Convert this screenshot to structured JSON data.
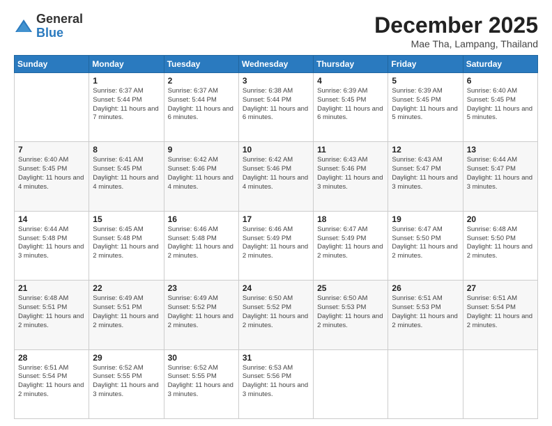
{
  "logo": {
    "general": "General",
    "blue": "Blue"
  },
  "title": {
    "month": "December 2025",
    "location": "Mae Tha, Lampang, Thailand"
  },
  "headers": [
    "Sunday",
    "Monday",
    "Tuesday",
    "Wednesday",
    "Thursday",
    "Friday",
    "Saturday"
  ],
  "weeks": [
    [
      {
        "day": "",
        "info": ""
      },
      {
        "day": "1",
        "info": "Sunrise: 6:37 AM\nSunset: 5:44 PM\nDaylight: 11 hours\nand 7 minutes."
      },
      {
        "day": "2",
        "info": "Sunrise: 6:37 AM\nSunset: 5:44 PM\nDaylight: 11 hours\nand 6 minutes."
      },
      {
        "day": "3",
        "info": "Sunrise: 6:38 AM\nSunset: 5:44 PM\nDaylight: 11 hours\nand 6 minutes."
      },
      {
        "day": "4",
        "info": "Sunrise: 6:39 AM\nSunset: 5:45 PM\nDaylight: 11 hours\nand 6 minutes."
      },
      {
        "day": "5",
        "info": "Sunrise: 6:39 AM\nSunset: 5:45 PM\nDaylight: 11 hours\nand 5 minutes."
      },
      {
        "day": "6",
        "info": "Sunrise: 6:40 AM\nSunset: 5:45 PM\nDaylight: 11 hours\nand 5 minutes."
      }
    ],
    [
      {
        "day": "7",
        "info": "Sunrise: 6:40 AM\nSunset: 5:45 PM\nDaylight: 11 hours\nand 4 minutes."
      },
      {
        "day": "8",
        "info": "Sunrise: 6:41 AM\nSunset: 5:45 PM\nDaylight: 11 hours\nand 4 minutes."
      },
      {
        "day": "9",
        "info": "Sunrise: 6:42 AM\nSunset: 5:46 PM\nDaylight: 11 hours\nand 4 minutes."
      },
      {
        "day": "10",
        "info": "Sunrise: 6:42 AM\nSunset: 5:46 PM\nDaylight: 11 hours\nand 4 minutes."
      },
      {
        "day": "11",
        "info": "Sunrise: 6:43 AM\nSunset: 5:46 PM\nDaylight: 11 hours\nand 3 minutes."
      },
      {
        "day": "12",
        "info": "Sunrise: 6:43 AM\nSunset: 5:47 PM\nDaylight: 11 hours\nand 3 minutes."
      },
      {
        "day": "13",
        "info": "Sunrise: 6:44 AM\nSunset: 5:47 PM\nDaylight: 11 hours\nand 3 minutes."
      }
    ],
    [
      {
        "day": "14",
        "info": "Sunrise: 6:44 AM\nSunset: 5:48 PM\nDaylight: 11 hours\nand 3 minutes."
      },
      {
        "day": "15",
        "info": "Sunrise: 6:45 AM\nSunset: 5:48 PM\nDaylight: 11 hours\nand 2 minutes."
      },
      {
        "day": "16",
        "info": "Sunrise: 6:46 AM\nSunset: 5:48 PM\nDaylight: 11 hours\nand 2 minutes."
      },
      {
        "day": "17",
        "info": "Sunrise: 6:46 AM\nSunset: 5:49 PM\nDaylight: 11 hours\nand 2 minutes."
      },
      {
        "day": "18",
        "info": "Sunrise: 6:47 AM\nSunset: 5:49 PM\nDaylight: 11 hours\nand 2 minutes."
      },
      {
        "day": "19",
        "info": "Sunrise: 6:47 AM\nSunset: 5:50 PM\nDaylight: 11 hours\nand 2 minutes."
      },
      {
        "day": "20",
        "info": "Sunrise: 6:48 AM\nSunset: 5:50 PM\nDaylight: 11 hours\nand 2 minutes."
      }
    ],
    [
      {
        "day": "21",
        "info": "Sunrise: 6:48 AM\nSunset: 5:51 PM\nDaylight: 11 hours\nand 2 minutes."
      },
      {
        "day": "22",
        "info": "Sunrise: 6:49 AM\nSunset: 5:51 PM\nDaylight: 11 hours\nand 2 minutes."
      },
      {
        "day": "23",
        "info": "Sunrise: 6:49 AM\nSunset: 5:52 PM\nDaylight: 11 hours\nand 2 minutes."
      },
      {
        "day": "24",
        "info": "Sunrise: 6:50 AM\nSunset: 5:52 PM\nDaylight: 11 hours\nand 2 minutes."
      },
      {
        "day": "25",
        "info": "Sunrise: 6:50 AM\nSunset: 5:53 PM\nDaylight: 11 hours\nand 2 minutes."
      },
      {
        "day": "26",
        "info": "Sunrise: 6:51 AM\nSunset: 5:53 PM\nDaylight: 11 hours\nand 2 minutes."
      },
      {
        "day": "27",
        "info": "Sunrise: 6:51 AM\nSunset: 5:54 PM\nDaylight: 11 hours\nand 2 minutes."
      }
    ],
    [
      {
        "day": "28",
        "info": "Sunrise: 6:51 AM\nSunset: 5:54 PM\nDaylight: 11 hours\nand 2 minutes."
      },
      {
        "day": "29",
        "info": "Sunrise: 6:52 AM\nSunset: 5:55 PM\nDaylight: 11 hours\nand 3 minutes."
      },
      {
        "day": "30",
        "info": "Sunrise: 6:52 AM\nSunset: 5:55 PM\nDaylight: 11 hours\nand 3 minutes."
      },
      {
        "day": "31",
        "info": "Sunrise: 6:53 AM\nSunset: 5:56 PM\nDaylight: 11 hours\nand 3 minutes."
      },
      {
        "day": "",
        "info": ""
      },
      {
        "day": "",
        "info": ""
      },
      {
        "day": "",
        "info": ""
      }
    ]
  ]
}
